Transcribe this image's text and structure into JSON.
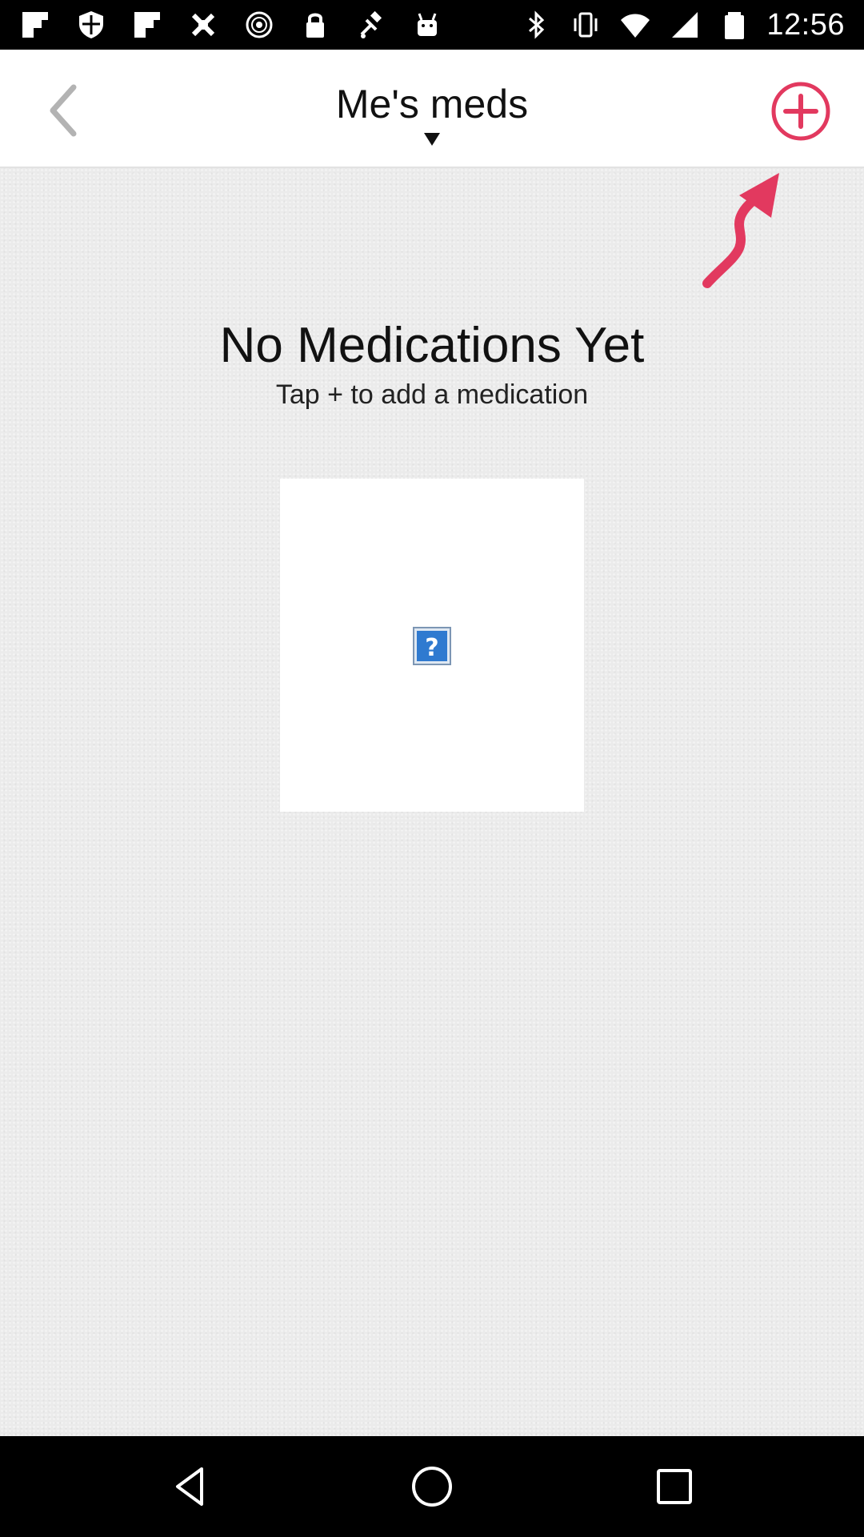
{
  "status_bar": {
    "time": "12:56",
    "left_icons": [
      "flipboard-icon",
      "shield-icon",
      "flipboard-icon",
      "tools-icon",
      "disc-icon",
      "lock-icon",
      "fake-gps-icon",
      "android-icon"
    ],
    "right_icons": [
      "bluetooth-icon",
      "vibrate-icon",
      "wifi-icon",
      "signal-icon",
      "battery-icon"
    ]
  },
  "header": {
    "title": "Me's meds",
    "back_icon": "chevron-left-icon",
    "dropdown_icon": "caret-down-icon",
    "add_icon": "plus-circle-icon",
    "accent_color": "#e2395f"
  },
  "empty_state": {
    "title": "No Medications Yet",
    "subtitle": "Tap + to add a medication",
    "hint_icon": "curved-arrow-icon",
    "image_icon": "missing-image-icon"
  },
  "nav_bar": {
    "buttons": [
      "back-triangle-icon",
      "home-circle-icon",
      "recents-square-icon"
    ]
  }
}
